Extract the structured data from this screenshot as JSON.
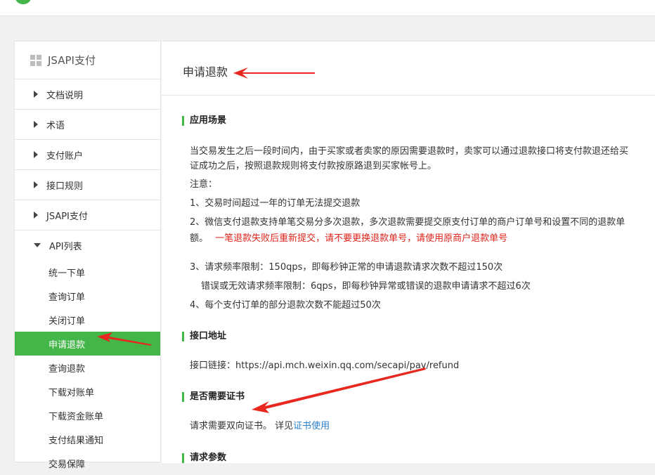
{
  "sidebar": {
    "header": "JSAPI支付",
    "items": [
      {
        "label": "文档说明"
      },
      {
        "label": "术语"
      },
      {
        "label": "支付账户"
      },
      {
        "label": "接口规则"
      },
      {
        "label": "JSAPI支付"
      },
      {
        "label": "API列表"
      }
    ],
    "sub_items": [
      {
        "label": "统一下单"
      },
      {
        "label": "查询订单"
      },
      {
        "label": "关闭订单"
      },
      {
        "label": "申请退款"
      },
      {
        "label": "查询退款"
      },
      {
        "label": "下载对账单"
      },
      {
        "label": "下载资金账单"
      },
      {
        "label": "支付结果通知"
      },
      {
        "label": "交易保障"
      }
    ]
  },
  "content": {
    "title": "申请退款",
    "sections": {
      "scenario": {
        "heading": "应用场景",
        "line1": "当交易发生之后一段时间内，由于买家或者卖家的原因需要退款时，卖家可以通过退款接口将支付款退还给买",
        "line2": "证成功之后，按照退款规则将支付款按原路退到买家帐号上。",
        "note_label": "注意：",
        "note1": "1、交易时间超过一年的订单无法提交退款",
        "note2": "2、微信支付退款支持单笔交易分多次退款，多次退款需要提交原支付订单的商户订单号和设置不同的退款单",
        "note2_cont": "额。",
        "note2_red": "一笔退款失败后重新提交，请不要更换退款单号，请使用原商户退款单号",
        "note3": "3、请求频率限制：150qps，即每秒钟正常的申请退款请求次数不超过150次",
        "note3_sub": "错误或无效请求频率限制：6qps，即每秒钟异常或错误的退款申请请求不超过6次",
        "note4": "4、每个支付订单的部分退款次数不能超过50次"
      },
      "endpoint": {
        "heading": "接口地址",
        "label": "接口链接：",
        "url": "https://api.mch.weixin.qq.com/secapi/pay/refund"
      },
      "cert": {
        "heading": "是否需要证书",
        "text": "请求需要双向证书。 详见",
        "link": "证书使用"
      },
      "params": {
        "heading": "请求参数"
      }
    }
  },
  "colors": {
    "accent": "#44b549",
    "warning_red": "#e0241c",
    "link_blue": "#2a7fc7",
    "annotation_arrow": "#e8281e"
  }
}
